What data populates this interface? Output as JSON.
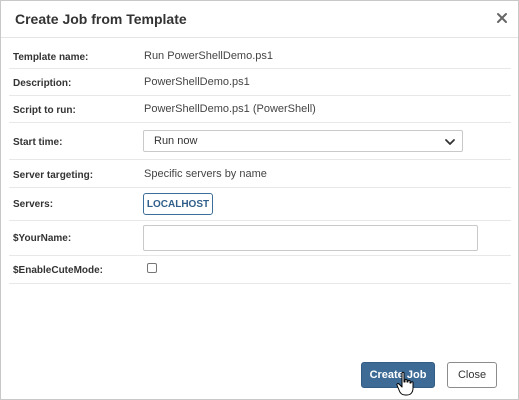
{
  "dialog": {
    "title": "Create Job from Template"
  },
  "form": {
    "template_name": {
      "label": "Template name:",
      "value": "Run PowerShellDemo.ps1"
    },
    "description": {
      "label": "Description:",
      "value": "PowerShellDemo.ps1"
    },
    "script": {
      "label": "Script to run:",
      "value": "PowerShellDemo.ps1 (PowerShell)"
    },
    "start_time": {
      "label": "Start time:",
      "selected": "Run now"
    },
    "server_targeting": {
      "label": "Server targeting:",
      "value": "Specific servers by name"
    },
    "servers": {
      "label": "Servers:",
      "items": [
        "LOCALHOST"
      ]
    },
    "your_name": {
      "label": "$YourName:",
      "value": ""
    },
    "enable_cute_mode": {
      "label": "$EnableCuteMode:",
      "checked": false
    }
  },
  "footer": {
    "create_label": "Create Job",
    "close_label": "Close"
  },
  "colors": {
    "primary": "#3d6b96",
    "server_tag": "#2f5f8a"
  },
  "icons": {
    "close": "close-icon",
    "dropdown": "chevron-down-icon",
    "cursor": "hand-cursor-icon"
  }
}
